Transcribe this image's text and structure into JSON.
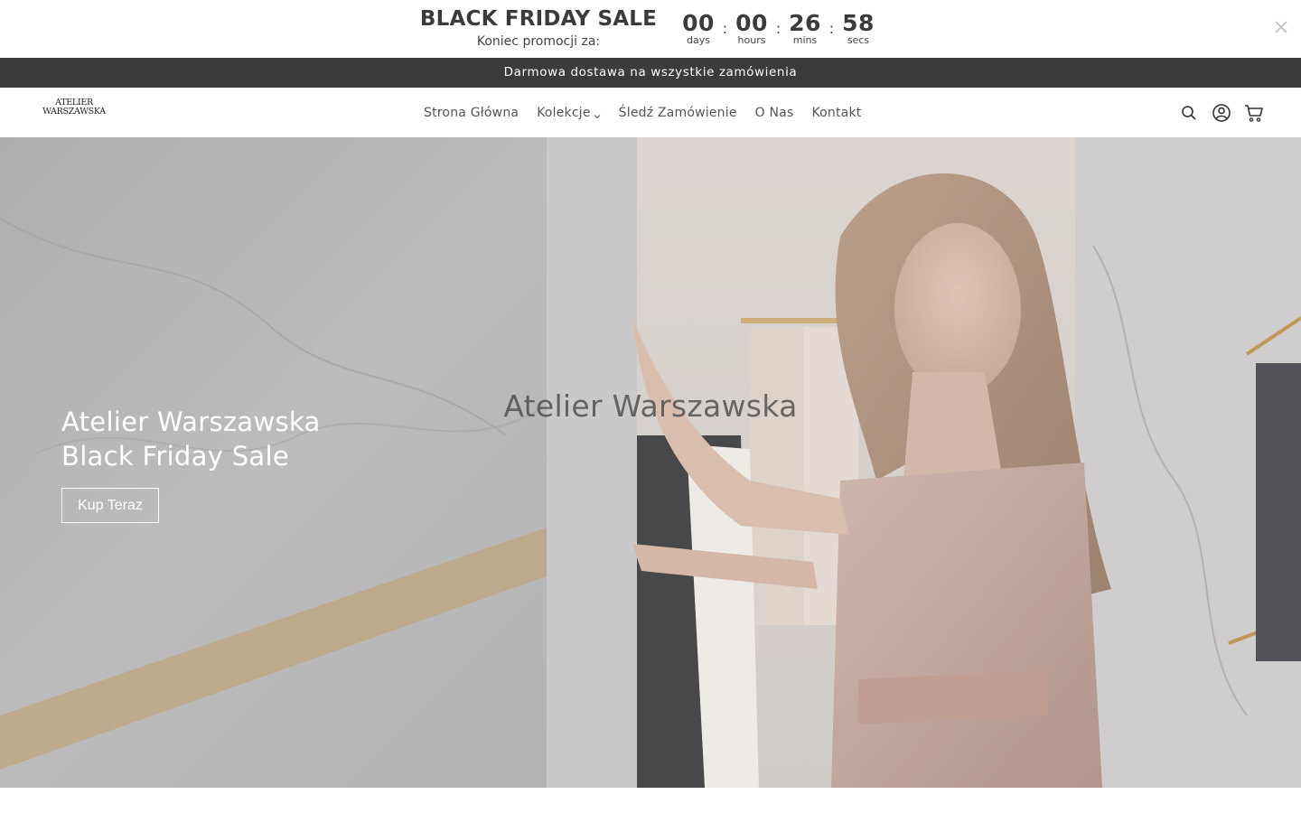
{
  "promo": {
    "title": "BLACK FRIDAY SALE",
    "subtitle": "Koniec promocji za:",
    "countdown": [
      {
        "value": "00",
        "label": "days"
      },
      {
        "value": "00",
        "label": "hours"
      },
      {
        "value": "26",
        "label": "mins"
      },
      {
        "value": "58",
        "label": "secs"
      }
    ],
    "separator": ":",
    "close_icon": "close-icon"
  },
  "announcement": {
    "text": "Darmowa dostawa na wszystkie zamówienia"
  },
  "header": {
    "logo": {
      "line1": "ATELIER",
      "line2": "WARSZAWSKA"
    },
    "nav": [
      {
        "label": "Strona Główna"
      },
      {
        "label": "Kolekcje",
        "has_dropdown": true
      },
      {
        "label": "Śledź Zamówienie"
      },
      {
        "label": "O Nas"
      },
      {
        "label": "Kontakt"
      }
    ],
    "icons": [
      "search-icon",
      "account-icon",
      "cart-icon"
    ]
  },
  "hero": {
    "heading_line1": "Atelier Warszawska",
    "heading_line2": "Black Friday Sale",
    "button_label": "Kup Teraz",
    "overlay_title": "Atelier Warszawska"
  },
  "colors": {
    "announcement_bg": "#3b3b3b",
    "text_dark": "#3b3b3b",
    "hero_text": "#ffffff"
  }
}
